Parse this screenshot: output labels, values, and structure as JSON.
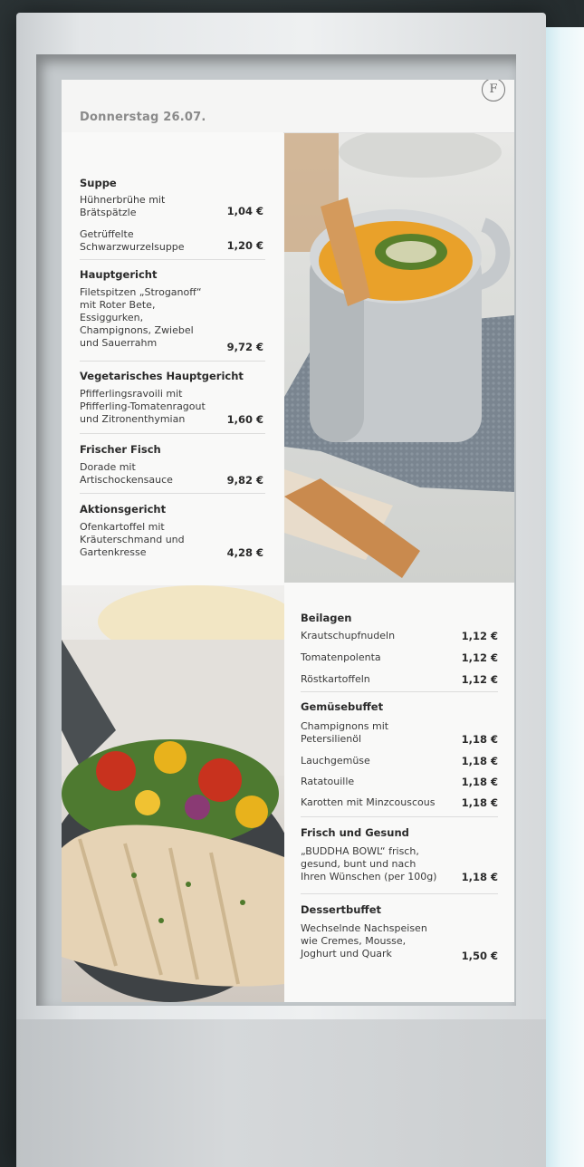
{
  "header": {
    "date": "Donnerstag 26.07.",
    "logo": "F"
  },
  "left_menu": [
    {
      "category": "Suppe",
      "items": [
        {
          "name": "Hühnerbrühe mit\nBrätspätzle",
          "price": "1,04 €"
        },
        {
          "name": "Getrüffelte\nSchwarzwurzelsuppe",
          "price": "1,20 €"
        }
      ]
    },
    {
      "category": "Hauptgericht",
      "items": [
        {
          "name": "Filetspitzen „Stroganoff“\nmit Roter Bete,\nEssiggurken,\nChampignons, Zwiebel\nund Sauerrahm",
          "price": "9,72 €"
        }
      ]
    },
    {
      "category": "Vegetarisches Hauptgericht",
      "items": [
        {
          "name": "Pfifferlingsravoili mit\nPfifferling-Tomatenragout\nund Zitronenthymian",
          "price": "1,60 €"
        }
      ]
    },
    {
      "category": "Frischer Fisch",
      "items": [
        {
          "name": "Dorade mit\nArtischockensauce",
          "price": "9,82 €"
        }
      ]
    },
    {
      "category": "Aktionsgericht",
      "items": [
        {
          "name": "Ofenkartoffel mit\nKräuterschmand und\nGartenkresse",
          "price": "4,28 €"
        }
      ]
    }
  ],
  "right_menu": [
    {
      "category": "Beilagen",
      "items": [
        {
          "name": "Krautschupfnudeln",
          "price": "1,12 €"
        },
        {
          "name": "Tomatenpolenta",
          "price": "1,12 €"
        },
        {
          "name": "Röstkartoffeln",
          "price": "1,12 €"
        }
      ]
    },
    {
      "category": "Gemüsebuffet",
      "items": [
        {
          "name": "Champignons mit\nPetersilienöl",
          "price": "1,18 €"
        },
        {
          "name": "Lauchgemüse",
          "price": "1,18 €"
        },
        {
          "name": "Ratatouille",
          "price": "1,18 €"
        },
        {
          "name": "Karotten mit Minzcouscous",
          "price": "1,18 €"
        }
      ]
    },
    {
      "category": "Frisch und Gesund",
      "items": [
        {
          "name": "„BUDDHA BOWL“ frisch,\ngesund, bunt und nach\nIhren Wünschen (per 100g)",
          "price": "1,18 €"
        }
      ]
    },
    {
      "category": "Dessertbuffet",
      "items": [
        {
          "name": "Wechselnde Nachspeisen\nwie Cremes, Mousse,\nJoghurt und Quark",
          "price": "1,50 €"
        }
      ]
    }
  ],
  "colors": {
    "soup": "#e8a72a",
    "mug": "#c8cbcd",
    "towel": "#7d8791",
    "pepper_red": "#c8321e",
    "pepper_yellow": "#e8b21c",
    "chicken": "#e9d8bf"
  }
}
